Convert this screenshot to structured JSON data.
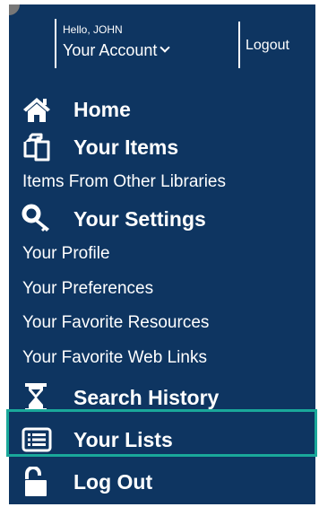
{
  "header": {
    "greeting": "Hello, JOHN",
    "account_label": "Your Account",
    "logout_label": "Logout"
  },
  "menu": {
    "home": "Home",
    "your_items": "Your Items",
    "items_other_libraries": "Items From Other Libraries",
    "your_settings": "Your Settings",
    "your_profile": "Your Profile",
    "your_preferences": "Your Preferences",
    "favorite_resources": "Your Favorite Resources",
    "favorite_web_links": "Your Favorite Web Links",
    "search_history": "Search History",
    "your_lists": "Your Lists",
    "log_out": "Log Out"
  },
  "icons": {
    "home": "home-icon",
    "your_items": "copy-items-icon",
    "your_settings": "key-icon",
    "search_history": "hourglass-icon",
    "your_lists": "list-icon",
    "log_out": "unlock-icon",
    "account_dropdown": "chevron-down-icon"
  },
  "colors": {
    "panel_background": "#0e3561",
    "text": "#ffffff",
    "highlight_border": "#1aa89a"
  },
  "state": {
    "highlighted_item": "your_lists"
  }
}
